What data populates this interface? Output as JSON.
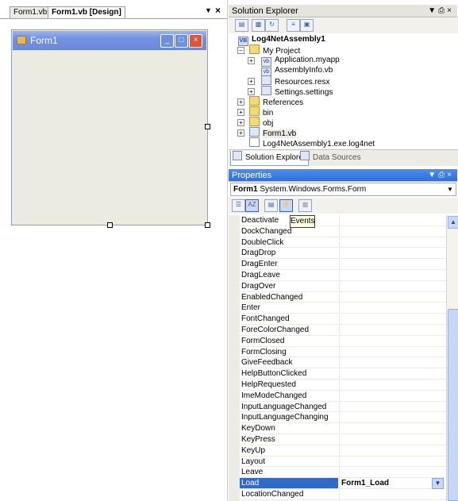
{
  "designer": {
    "tabs": [
      {
        "label": "Form1.vb"
      },
      {
        "label": "Form1.vb [Design]"
      }
    ],
    "pane_icons": [
      "pin-dropdown-icon",
      "close-icon"
    ],
    "form": {
      "title": "Form1"
    }
  },
  "solution_explorer": {
    "title": "Solution Explorer",
    "tree": [
      {
        "label": "Log4NetAssembly1",
        "icon": "vb-project-icon"
      },
      {
        "label": "My Project",
        "icon": "folder-icon"
      },
      {
        "label": "Application.myapp",
        "icon": "vb-file-icon"
      },
      {
        "label": "AssemblyInfo.vb",
        "icon": "vb-file-icon"
      },
      {
        "label": "Resources.resx",
        "icon": "resx-file-icon"
      },
      {
        "label": "Settings.settings",
        "icon": "settings-file-icon"
      },
      {
        "label": "References",
        "icon": "references-icon"
      },
      {
        "label": "bin",
        "icon": "folder-icon"
      },
      {
        "label": "obj",
        "icon": "folder-icon"
      },
      {
        "label": "Form1.vb",
        "icon": "form-file-icon"
      },
      {
        "label": "Log4NetAssembly1.exe.log4net",
        "icon": "file-icon"
      }
    ],
    "bottom_tabs": [
      {
        "label": "Solution Explorer"
      },
      {
        "label": "Data Sources"
      }
    ]
  },
  "properties": {
    "title": "Properties",
    "object_name": "Form1",
    "object_type": "System.Windows.Forms.Form",
    "tooltip": "Events",
    "events": [
      {
        "name": "Deactivate",
        "value": ""
      },
      {
        "name": "DockChanged",
        "value": ""
      },
      {
        "name": "DoubleClick",
        "value": ""
      },
      {
        "name": "DragDrop",
        "value": ""
      },
      {
        "name": "DragEnter",
        "value": ""
      },
      {
        "name": "DragLeave",
        "value": ""
      },
      {
        "name": "DragOver",
        "value": ""
      },
      {
        "name": "EnabledChanged",
        "value": ""
      },
      {
        "name": "Enter",
        "value": ""
      },
      {
        "name": "FontChanged",
        "value": ""
      },
      {
        "name": "ForeColorChanged",
        "value": ""
      },
      {
        "name": "FormClosed",
        "value": ""
      },
      {
        "name": "FormClosing",
        "value": ""
      },
      {
        "name": "GiveFeedback",
        "value": ""
      },
      {
        "name": "HelpButtonClicked",
        "value": ""
      },
      {
        "name": "HelpRequested",
        "value": ""
      },
      {
        "name": "ImeModeChanged",
        "value": ""
      },
      {
        "name": "InputLanguageChanged",
        "value": ""
      },
      {
        "name": "InputLanguageChanging",
        "value": ""
      },
      {
        "name": "KeyDown",
        "value": ""
      },
      {
        "name": "KeyPress",
        "value": ""
      },
      {
        "name": "KeyUp",
        "value": ""
      },
      {
        "name": "Layout",
        "value": ""
      },
      {
        "name": "Leave",
        "value": ""
      },
      {
        "name": "Load",
        "value": "Form1_Load",
        "selected": true
      },
      {
        "name": "LocationChanged",
        "value": ""
      }
    ]
  },
  "colors": {
    "selection": "#316ac5",
    "active_title": "#2d6ed8",
    "form_titlebar": "#7492e2"
  }
}
